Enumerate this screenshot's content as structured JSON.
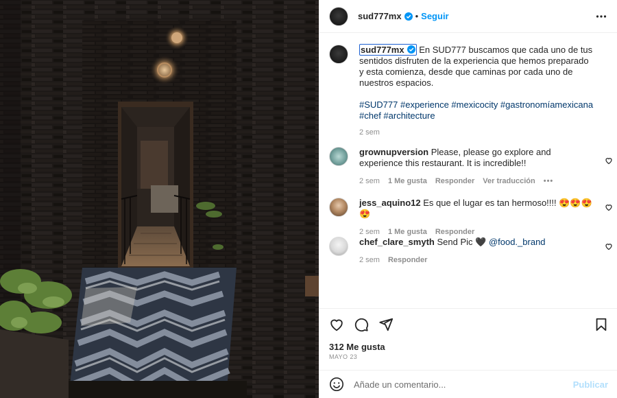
{
  "post": {
    "author": "sud777mx",
    "follow_label": "Seguir",
    "photo_alt": "Pasillo de piedra oscura con piso en zigzag",
    "icons": {
      "verified": "verified-badge-icon",
      "more": "more-options-icon"
    }
  },
  "caption": {
    "username": "sud777mx",
    "text": "En SUD777 buscamos que cada uno de tus sentidos disfruten de la experiencia que hemos preparado y esta comienza, desde que caminas por cada uno de nuestros espacios.",
    "hashtags": "#SUD777 #experience #mexicocity #gastronomíamexicana #chef #architecture",
    "time": "2 sem"
  },
  "comments": [
    {
      "username": "grownupversion",
      "text": "Please, please go explore and experience this restaurant. It is incredible!!",
      "time": "2 sem",
      "likes": "1 Me gusta",
      "reply": "Responder",
      "translate": "Ver traducción",
      "more": "•••"
    },
    {
      "username": "jess_aquino12",
      "text": "Es que el lugar es tan hermoso!!!! 😍😍😍😍",
      "time": "2 sem",
      "likes": "1 Me gusta",
      "reply": "Responder"
    },
    {
      "username": "chef_clare_smyth",
      "text": "Send Pic 🖤",
      "mention": "@food._brand",
      "time": "2 sem",
      "reply": "Responder"
    }
  ],
  "actions": {
    "likes": "312 Me gusta",
    "date": "MAYO 23",
    "icons": [
      "heart-icon",
      "comment-icon",
      "share-icon",
      "save-icon"
    ]
  },
  "composer": {
    "placeholder": "Añade un comentario...",
    "publish": "Publicar"
  },
  "colors": {
    "accent": "#0095f6",
    "link": "#00376b",
    "muted": "#8e8e8e",
    "publish_disabled": "#b2dffc"
  }
}
